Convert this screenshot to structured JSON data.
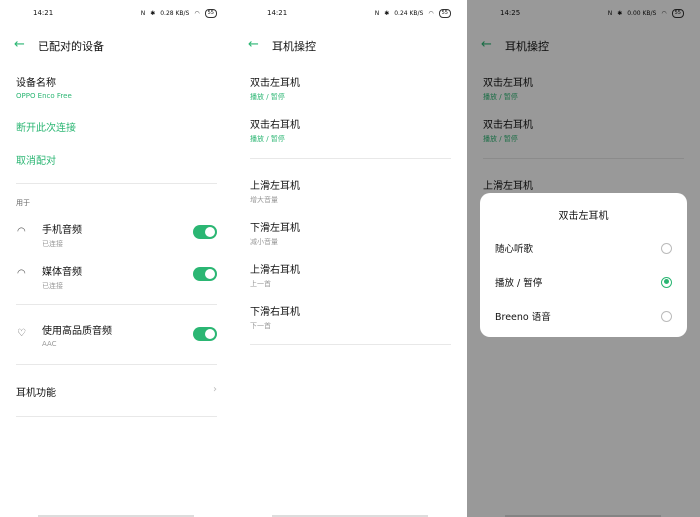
{
  "status_bars": [
    {
      "time": "14:21",
      "speed": "0.28 KB/S",
      "battery": "55"
    },
    {
      "time": "14:21",
      "speed": "0.24 KB/S",
      "battery": "55"
    },
    {
      "time": "14:25",
      "speed": "0.00 KB/S",
      "battery": "55"
    }
  ],
  "paired": {
    "title": "已配对的设备",
    "device_name_label": "设备名称",
    "device_name": "OPPO Enco Free",
    "disconnect": "断开此次连接",
    "unpair": "取消配对",
    "used_for": "用于",
    "items": [
      {
        "label": "手机音频",
        "status": "已连接",
        "on": true
      },
      {
        "label": "媒体音频",
        "status": "已连接",
        "on": true
      }
    ],
    "hq": {
      "label": "使用高品质音频",
      "codec": "AAC",
      "on": true
    },
    "features": "耳机功能"
  },
  "controls": {
    "title": "耳机操控",
    "items": [
      {
        "label": "双击左耳机",
        "value": "播放 / 暂停"
      },
      {
        "label": "双击右耳机",
        "value": "播放 / 暂停"
      },
      {
        "label": "上滑左耳机",
        "value": "增大音量"
      },
      {
        "label": "下滑左耳机",
        "value": "减小音量"
      },
      {
        "label": "上滑右耳机",
        "value": "上一首"
      },
      {
        "label": "下滑右耳机",
        "value": "下一首"
      }
    ]
  },
  "dialog": {
    "title": "双击左耳机",
    "options": [
      {
        "label": "随心听歌",
        "selected": false
      },
      {
        "label": "播放 / 暂停",
        "selected": true
      },
      {
        "label": "Breeno 语音",
        "selected": false
      }
    ]
  },
  "accent": "#2bb673"
}
